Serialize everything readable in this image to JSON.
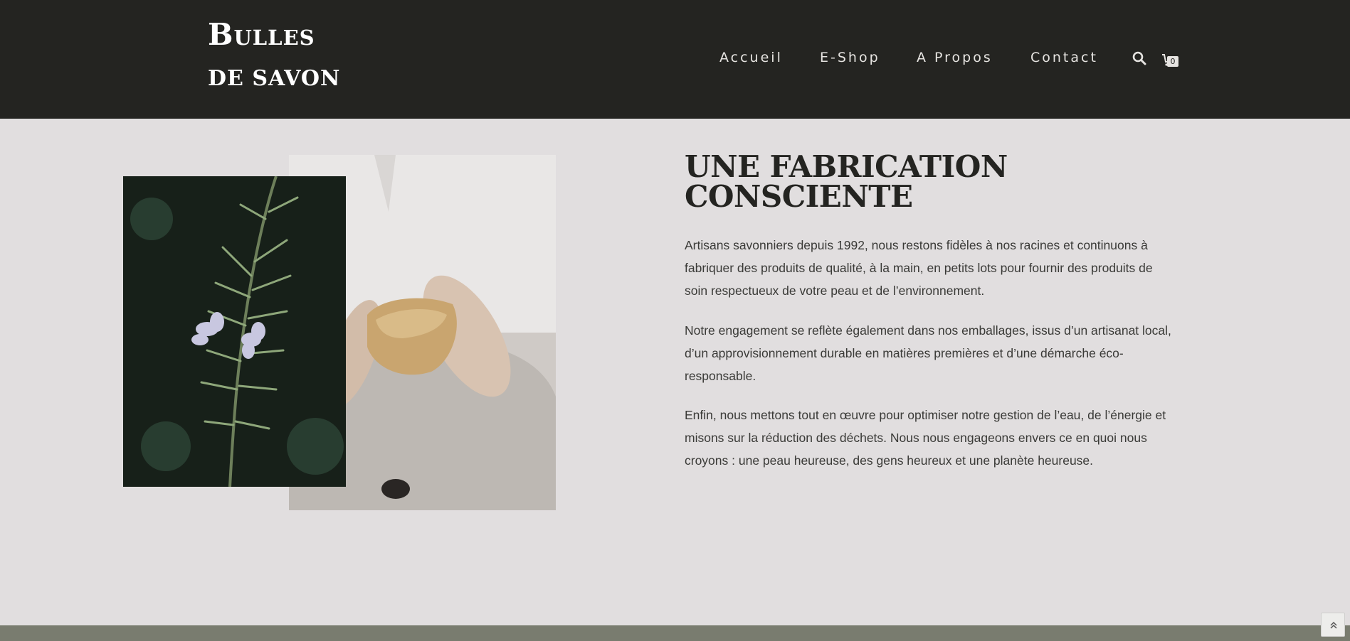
{
  "logo": {
    "line1": "Bulles",
    "line2": "DE SAVON"
  },
  "nav": {
    "items": [
      {
        "label": "Accueil"
      },
      {
        "label": "E-Shop"
      },
      {
        "label": "A Propos"
      },
      {
        "label": "Contact"
      }
    ],
    "cart_count": "0"
  },
  "section": {
    "title_line1": "UNE FABRICATION",
    "title_line2": "CONSCIENTE",
    "paragraphs": [
      "Artisans savonniers depuis 1992, nous restons fidèles à nos racines et continuons à fabriquer des produits de qualité, à la main, en petits lots pour fournir des produits de soin respectueux de votre peau et de l’environnement.",
      "Notre engagement se reflète également dans nos emballages, issus d’un artisanat local, d’un approvisionnement durable en matières premières et d’une démarche éco-responsable.",
      "Enfin, nous mettons tout en œuvre pour optimiser notre gestion de l’eau, de l’énergie et misons sur la réduction des déchets. Nous nous engageons envers ce en quoi nous croyons : une peau heureuse, des gens heureux et une planète heureuse."
    ]
  },
  "colors": {
    "header_bg": "#242421",
    "page_bg": "#e1dedf",
    "footer_band": "#797c6f"
  },
  "icons": {
    "search": "search-icon",
    "cart": "cart-icon",
    "back_to_top": "double-chevron-up-icon"
  }
}
